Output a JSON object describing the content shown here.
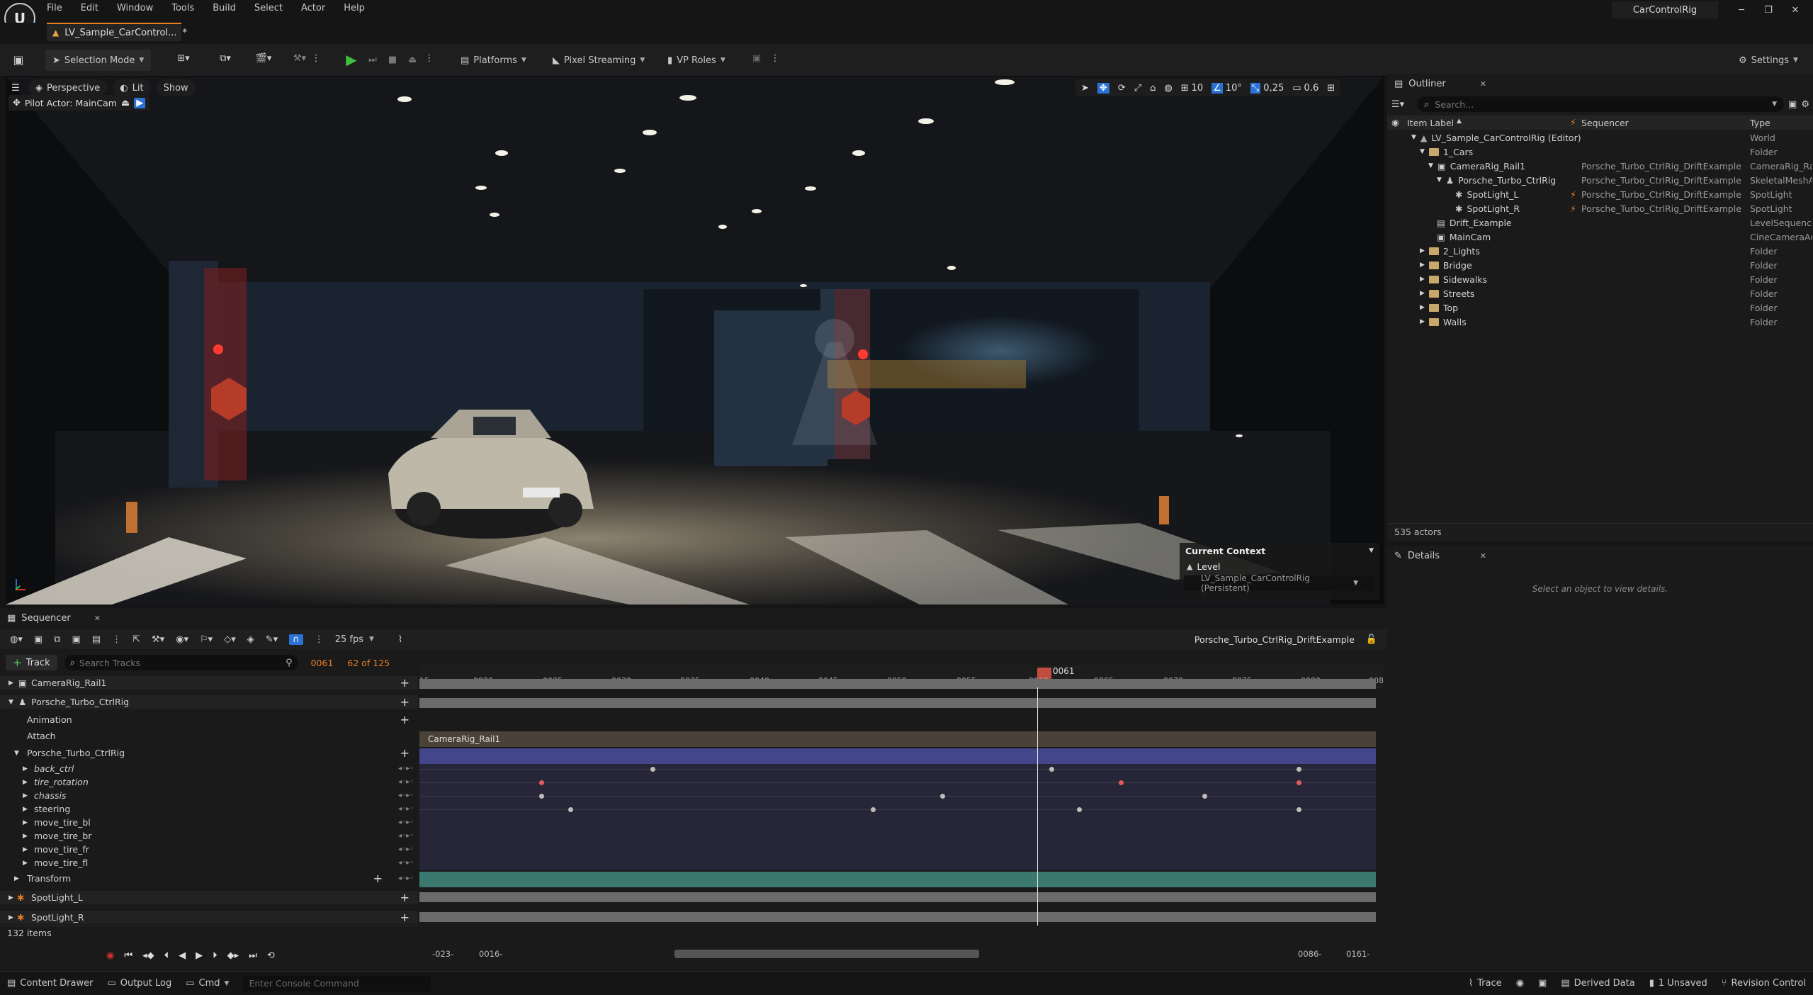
{
  "app": {
    "logo": "unreal-engine-logo",
    "menus": [
      "File",
      "Edit",
      "Window",
      "Tools",
      "Build",
      "Select",
      "Actor",
      "Help"
    ],
    "project_name": "CarControlRig",
    "level_tab": "LV_Sample_CarControl...",
    "level_tab_dirty": "*"
  },
  "toolbar": {
    "selection_mode": "Selection Mode",
    "platforms": "Platforms",
    "pixel_streaming": "Pixel Streaming",
    "vp_roles": "VP Roles",
    "settings": "Settings"
  },
  "viewport": {
    "perspective": "Perspective",
    "lit": "Lit",
    "show": "Show",
    "pilot_actor": "Pilot Actor: MainCam",
    "grid_size": "10",
    "rotation_snap": "10°",
    "scale_snap": "0,25",
    "camera_speed": "0.6",
    "context_title": "Current Context",
    "context_level_label": "Level",
    "context_level_value": "LV_Sample_CarControlRig (Persistent)"
  },
  "outliner": {
    "tab": "Outliner",
    "search_placeholder": "Search...",
    "col_label": "Item Label",
    "col_sequencer": "Sequencer",
    "col_type": "Type",
    "rows": [
      {
        "label": "LV_Sample_CarControlRig (Editor)",
        "seq": "",
        "type": "World"
      },
      {
        "label": "1_Cars",
        "seq": "",
        "type": "Folder"
      },
      {
        "label": "CameraRig_Rail1",
        "seq": "Porsche_Turbo_CtrlRig_DriftExample",
        "type": "CameraRig_Rail"
      },
      {
        "label": "Porsche_Turbo_CtrlRig",
        "seq": "Porsche_Turbo_CtrlRig_DriftExample",
        "type": "SkeletalMeshActor"
      },
      {
        "label": "SpotLight_L",
        "seq": "Porsche_Turbo_CtrlRig_DriftExample",
        "type": "SpotLight"
      },
      {
        "label": "SpotLight_R",
        "seq": "Porsche_Turbo_CtrlRig_DriftExample",
        "type": "SpotLight"
      },
      {
        "label": "Drift_Example",
        "seq": "",
        "type": "LevelSequenceActor"
      },
      {
        "label": "MainCam",
        "seq": "",
        "type": "CineCameraActor"
      },
      {
        "label": "2_Lights",
        "seq": "",
        "type": "Folder"
      },
      {
        "label": "Bridge",
        "seq": "",
        "type": "Folder"
      },
      {
        "label": "Sidewalks",
        "seq": "",
        "type": "Folder"
      },
      {
        "label": "Streets",
        "seq": "",
        "type": "Folder"
      },
      {
        "label": "Top",
        "seq": "",
        "type": "Folder"
      },
      {
        "label": "Walls",
        "seq": "",
        "type": "Folder"
      }
    ],
    "actor_count": "535 actors"
  },
  "details": {
    "tab": "Details",
    "empty_text": "Select an object to view details."
  },
  "sequencer": {
    "tab": "Sequencer",
    "fps": "25 fps",
    "sequence_name": "Porsche_Turbo_CtrlRig_DriftExample",
    "add_track": "Track",
    "search_placeholder": "Search Tracks",
    "current_frame": "0061",
    "frame_count": "62 of 125",
    "playhead_label": "0061",
    "ruler": [
      "15",
      "0020",
      "0025",
      "0030",
      "0035",
      "0040",
      "0045",
      "0050",
      "0055",
      "0060",
      "0065",
      "0070",
      "0075",
      "0080",
      "008"
    ],
    "tracks": [
      {
        "label": "CameraRig_Rail1"
      },
      {
        "label": "Porsche_Turbo_CtrlRig"
      },
      {
        "label": "Animation"
      },
      {
        "label": "Attach"
      },
      {
        "label": "Porsche_Turbo_CtrlRig"
      },
      {
        "label": "back_ctrl"
      },
      {
        "label": "tire_rotation"
      },
      {
        "label": "chassis"
      },
      {
        "label": "steering"
      },
      {
        "label": "move_tire_bl"
      },
      {
        "label": "move_tire_br"
      },
      {
        "label": "move_tire_fr"
      },
      {
        "label": "move_tire_fl"
      },
      {
        "label": "Transform"
      },
      {
        "label": "SpotLight_L"
      },
      {
        "label": "SpotLight_R"
      }
    ],
    "attach_section": "CameraRig_Rail1",
    "item_count": "132 items",
    "range_start_out": "-023-",
    "range_start_in": "0016-",
    "range_end_in": "0086-",
    "range_end_out": "0161-"
  },
  "statusbar": {
    "content_drawer": "Content Drawer",
    "output_log": "Output Log",
    "cmd": "Cmd",
    "console_placeholder": "Enter Console Command",
    "trace": "Trace",
    "derived_data": "Derived Data",
    "unsaved": "1 Unsaved",
    "revision_control": "Revision Control"
  }
}
